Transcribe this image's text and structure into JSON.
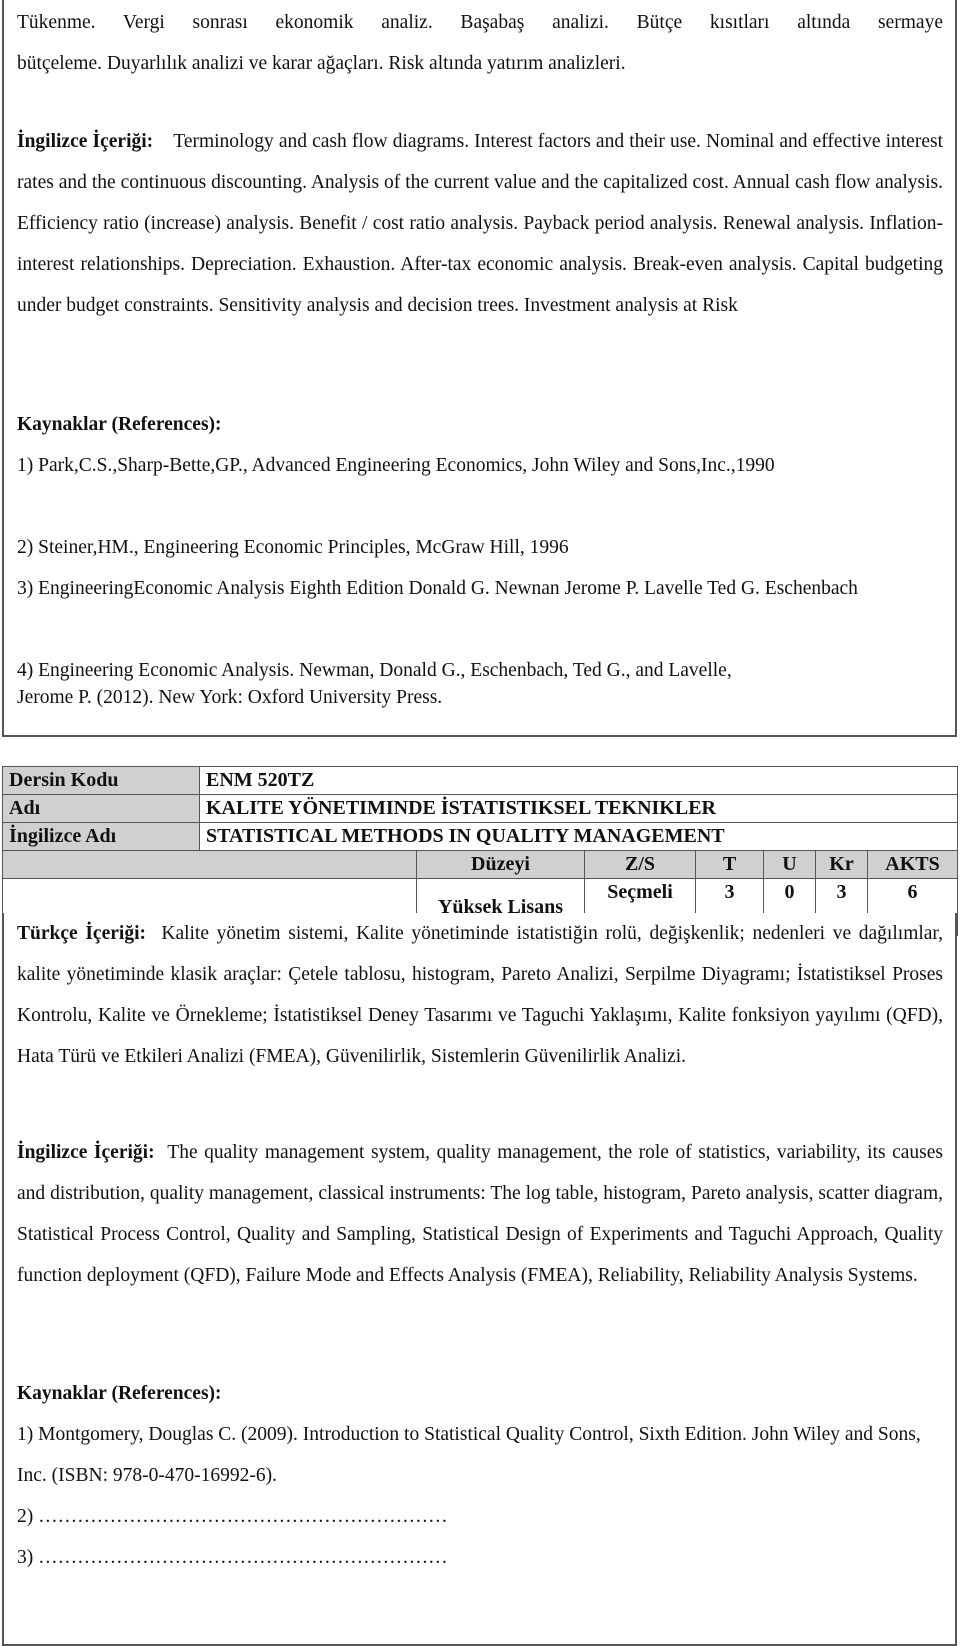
{
  "course1": {
    "turkish_content_tail": [
      "Tükenme. Vergi sonrası ekonomik analiz. Başabaş analizi. Bütçe kısıtları altında sermaye",
      "bütçeleme. Duyarlılık analizi ve karar ağaçları. Risk altında yatırım analizleri."
    ],
    "english_content_label": "İngilizce İçeriği:",
    "english_content": "Terminology and cash flow diagrams. Interest factors and their use. Nominal and effective interest rates and the continuous discounting. Analysis of the current value and the capitalized cost. Annual cash flow analysis. Efficiency ratio (increase) analysis. Benefit / cost ratio analysis. Payback period analysis. Renewal analysis. Inflation-interest relationships. Depreciation. Exhaustion. After-tax economic analysis. Break-even analysis. Capital budgeting under budget constraints. Sensitivity analysis and decision trees. Investment analysis at Risk",
    "references_label": "Kaynaklar (References):",
    "references": [
      "1) Park,C.S.,Sharp-Bette,GP., Advanced Engineering Economics, John Wiley and Sons,Inc.,1990",
      "2) Steiner,HM., Engineering Economic Principles, McGraw Hill, 1996",
      "3) EngineeringEconomic Analysis Eighth Edition Donald G. Newnan Jerome P. Lavelle Ted G. Eschenbach",
      "4) Engineering Economic Analysis. Newman, Donald G., Eschenbach, Ted G., and Lavelle,",
      "Jerome P. (2012).  New York: Oxford University Press."
    ]
  },
  "course2": {
    "code_label": "Dersin Kodu",
    "code": "ENM 520TZ",
    "name_label": "Adı",
    "name": "KALITE YÖNETIMINDE İSTATISTIKSEL TEKNIKLER",
    "english_name_label": "İngilizce Adı",
    "english_name": "STATISTICAL METHODS IN QUALITY MANAGEMENT",
    "attributes_header": [
      "Düzeyi",
      "Z/S",
      "T",
      "U",
      "Kr",
      "AKTS"
    ],
    "attributes_values": [
      "Yüksek Lisans",
      "Seçmeli",
      "3",
      "0",
      "3",
      "6"
    ],
    "turkish_content_label": "Türkçe İçeriği:",
    "turkish_content": "Kalite yönetim sistemi, Kalite yönetiminde istatistiğin rolü, değişkenlik; nedenleri ve dağılımlar, kalite yönetiminde klasik araçlar: Çetele tablosu, histogram, Pareto Analizi, Serpilme Diyagramı; İstatistiksel Proses Kontrolu, Kalite ve Örnekleme; İstatistiksel Deney Tasarımı ve Taguchi Yaklaşımı, Kalite fonksiyon yayılımı (QFD), Hata Türü ve Etkileri Analizi (FMEA), Güvenilirlik, Sistemlerin Güvenilirlik Analizi.",
    "english_content_label": "İngilizce İçeriği:",
    "english_content": "The quality management system, quality management, the role of statistics, variability, its causes and distribution, quality management, classical instruments: The log table, histogram, Pareto analysis, scatter diagram, Statistical Process Control, Quality and Sampling, Statistical Design of Experiments and Taguchi Approach, Quality function deployment (QFD), Failure Mode and Effects Analysis (FMEA), Reliability, Reliability Analysis Systems.",
    "references_label": "Kaynaklar (References):",
    "references": [
      "1) Montgomery, Douglas C. (2009). Introduction to Statistical Quality Control, Sixth Edition. John Wiley and Sons, Inc. (ISBN: 978-0-470-16992-6).",
      "2) ………………………………………………………",
      "3) ………………………………………………………"
    ]
  }
}
